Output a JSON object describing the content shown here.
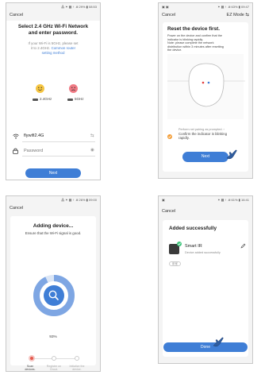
{
  "p1": {
    "status": "⁂ ✶ ▩ ↑ .ill 29% ▮ 08:53",
    "cancel": "Cancel",
    "title1": "Select 2.4 GHz Wi-Fi Network",
    "title2": "and enter password.",
    "info1": "If your Wi-Fi is 5GHz, please set",
    "info2": "it to 2.4GHz.",
    "info_link": "Common router",
    "info3": "setting method",
    "good_label": "2.4GHz",
    "bad_label": "5GHz",
    "wifi_name": "flywifi2.4G",
    "password_placeholder": "Password",
    "next": "Next"
  },
  "p2": {
    "status": "✶ ▩ ↑ .ill 63% ▮ 09:47",
    "cancel": "Cancel",
    "mode": "EZ Mode ⇆",
    "heading": "Reset the device first.",
    "desc1": "Power on the device and confirm that the",
    "desc2": "indicator is blinking rapidly.",
    "desc3": "Note: please complete the network",
    "desc4": "distribution within 3 minutes after resetting",
    "desc5": "the device.",
    "help": "Perform net pairing as prompted. ›",
    "confirm1": "Confirm the indicator is blinking",
    "confirm2": "rapidly.",
    "next": "Next"
  },
  "p3": {
    "status": "⁂ ✶ ▩ ↑ .ill 26% ▮ 09:00",
    "cancel": "Cancel",
    "title": "Adding device...",
    "subtitle": "Ensure that the Wi-Fi signal is good.",
    "progress_text": "93%",
    "progress_value": 93,
    "step1": "Scan devices.",
    "step2": "Register on Cloud.",
    "step3": "Initialize the device."
  },
  "p4": {
    "status": "✶ ▩ ↑ .ill 61% ▮ 16:41",
    "cancel": "Cancel",
    "title": "Added successfully",
    "device_name": "Smart IR",
    "device_status": "Device added successfully",
    "room_tag": "卧室",
    "done": "Done"
  }
}
